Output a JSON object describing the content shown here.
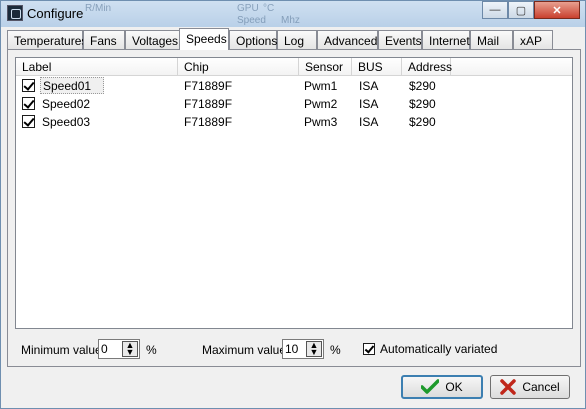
{
  "window": {
    "title": "Configure",
    "background_text": [
      "R/Min",
      "GPU",
      "Speed",
      "°C",
      "Mhz"
    ],
    "controls": {
      "minimize": "—",
      "maximize": "▢",
      "close": "✕"
    }
  },
  "tabs": [
    "Temperatures",
    "Fans",
    "Voltages",
    "Speeds",
    "Options",
    "Log",
    "Advanced",
    "Events",
    "Internet",
    "Mail",
    "xAP"
  ],
  "active_tab": "Speeds",
  "table": {
    "columns": [
      "Label",
      "Chip",
      "Sensor",
      "BUS",
      "Address"
    ],
    "rows": [
      {
        "checked": true,
        "label": "Speed01",
        "chip": "F71889F",
        "sensor": "Pwm1",
        "bus": "ISA",
        "address": "$290"
      },
      {
        "checked": true,
        "label": "Speed02",
        "chip": "F71889F",
        "sensor": "Pwm2",
        "bus": "ISA",
        "address": "$290"
      },
      {
        "checked": true,
        "label": "Speed03",
        "chip": "F71889F",
        "sensor": "Pwm3",
        "bus": "ISA",
        "address": "$290"
      }
    ]
  },
  "options": {
    "min_label": "Minimum value",
    "min_value": "0",
    "min_unit": "%",
    "max_label": "Maximum value",
    "max_value": "10",
    "max_unit": "%",
    "auto_label": "Automatically variated",
    "auto_checked": true
  },
  "buttons": {
    "ok": "OK",
    "cancel": "Cancel"
  },
  "colors": {
    "ok_icon": "#1e9a2c",
    "cancel_icon": "#c0261a",
    "accent": "#3c7fb1"
  }
}
